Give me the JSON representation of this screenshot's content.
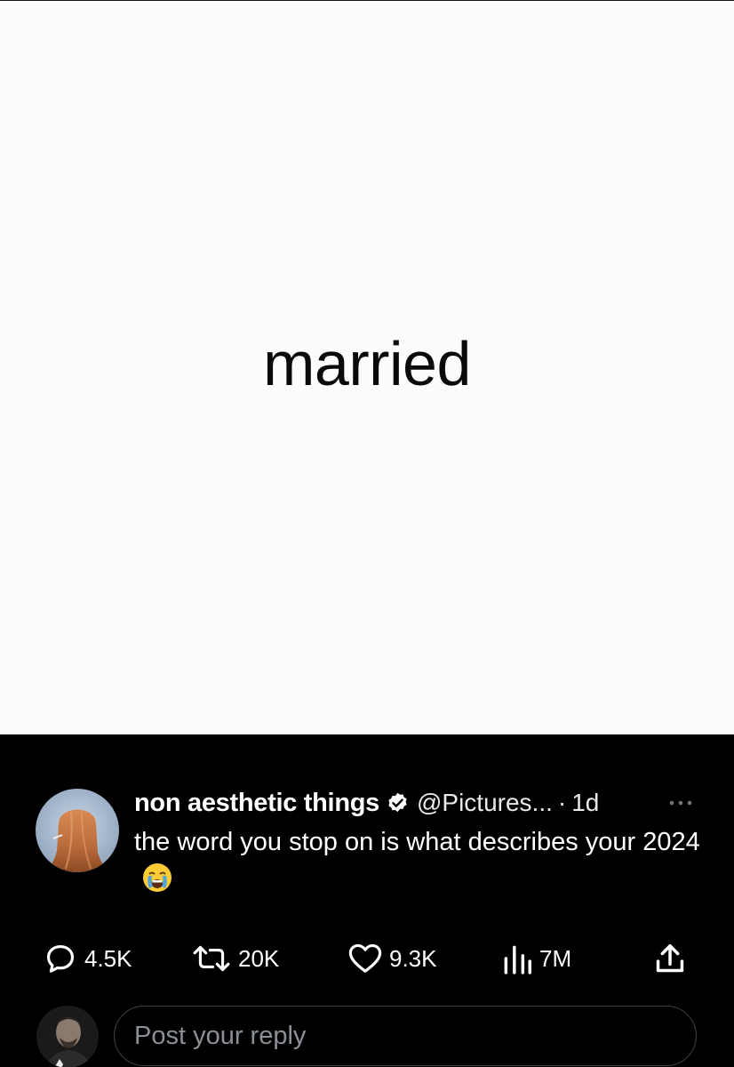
{
  "post_image": {
    "word": "married"
  },
  "tweet": {
    "author_name": "non aesthetic things",
    "handle": "@Pictures...",
    "separator": "·",
    "time": "1d",
    "text": "the word you stop on is what describes your 2024",
    "emoji": "loudly-crying-face",
    "verified": true
  },
  "actions": {
    "replies": "4.5K",
    "reposts": "20K",
    "likes": "9.3K",
    "views": "7M"
  },
  "reply_box": {
    "placeholder": "Post your reply"
  },
  "colors": {
    "background": "#000000",
    "media_background": "#fcfcfc",
    "text": "#ffffff",
    "placeholder": "#8b9096",
    "input_border": "#3e4144"
  }
}
